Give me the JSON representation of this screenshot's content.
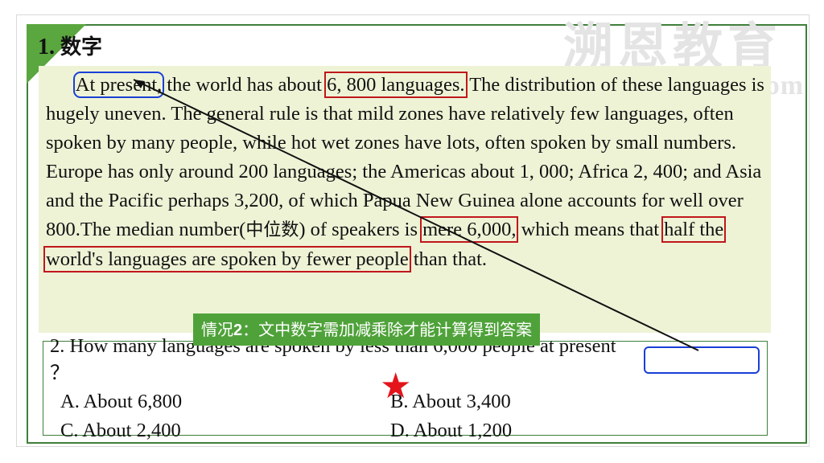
{
  "heading": {
    "number": "1.",
    "title": "数字"
  },
  "watermark": {
    "logo": "溯恩教育",
    "url": "www.suneduu.com"
  },
  "passage": {
    "s1_highlight": "At present,",
    "s1_text": " the world has about ",
    "s1_number": "6, 800 languages.",
    "s2": " The distribution of these languages is hugely uneven. The general rule is that mild zones have relatively few languages, often spoken by many people, while hot wet zones have lots, often spoken by small numbers. Europe has only around 200 languages; the Americas about 1, 000; Africa 2, 400; and Asia and the Pacific perhaps 3,200, of which Papua New Guinea alone accounts for well over 800.The median number(",
    "zh_median": "中位数",
    "s3": ") of speakers is ",
    "s3_highlight": "mere 6,000,",
    "s4": " which means that ",
    "s4_highlight": "half the world's languages are spoken by fewer people",
    "s5": " than that."
  },
  "banner": {
    "prefix": "情况",
    "num": "2",
    "text": "：文中数字需加减乘除才能计算得到答案"
  },
  "question": {
    "text": "2. How many languages are spoken by less than 6,000 people at present",
    "mark": "？"
  },
  "options": {
    "a": "A. About 6,800",
    "b": "B. About 3,400",
    "c": "C. About 2,400",
    "d": "D. About 1,200"
  },
  "star_glyph": "★",
  "colors": {
    "frame": "#3f7f3a",
    "passage_bg": "#eef3d6",
    "banner": "#4fa23a",
    "highlight_red": "#c0171b",
    "highlight_blue": "#1a3fd6",
    "star": "#e4141b"
  }
}
